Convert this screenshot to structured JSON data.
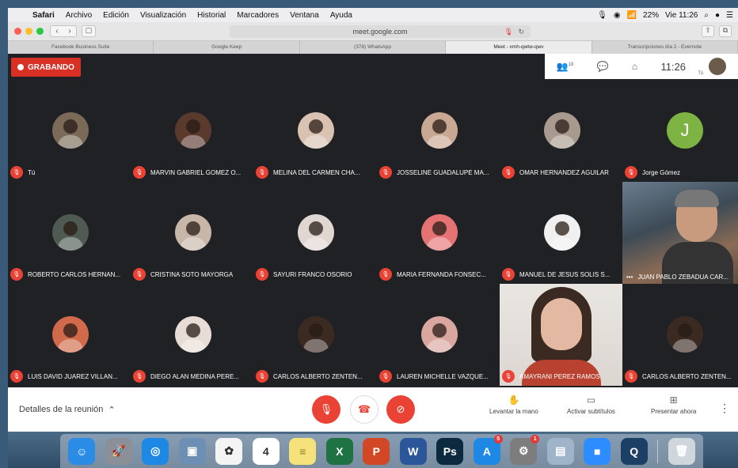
{
  "menubar": {
    "app": "Safari",
    "items": [
      "Archivo",
      "Edición",
      "Visualización",
      "Historial",
      "Marcadores",
      "Ventana",
      "Ayuda"
    ],
    "battery": "22%",
    "clock": "Vie 11:26"
  },
  "browser": {
    "url": "meet.google.com",
    "tabs": [
      {
        "label": "Facebook Business Suite",
        "active": false
      },
      {
        "label": "Google Keep",
        "active": false
      },
      {
        "label": "(378) WhatsApp",
        "active": false
      },
      {
        "label": "Meet - xmh-qwtw-qwv",
        "active": true
      },
      {
        "label": "Transcripciones día 2 - Evernote",
        "active": false
      }
    ]
  },
  "meet": {
    "recording_label": "GRABANDO",
    "participants_count": "18",
    "time": "11:26",
    "self_label": "Tú",
    "tiles": [
      {
        "name": "Tú",
        "type": "avatar",
        "color": "#7b6a58",
        "letter": ""
      },
      {
        "name": "MARVIN GABRIEL GOMEZ O...",
        "type": "avatar",
        "color": "#5b3a2e",
        "letter": ""
      },
      {
        "name": "MELINA DEL CARMEN CHA...",
        "type": "avatar",
        "color": "#d9c2b2",
        "letter": ""
      },
      {
        "name": "JOSSELINE GUADALUPE MA...",
        "type": "avatar",
        "color": "#c9a893",
        "letter": ""
      },
      {
        "name": "OMAR HERNANDEZ AGUILAR",
        "type": "avatar",
        "color": "#a89a8e",
        "letter": ""
      },
      {
        "name": "Jorge Gómez",
        "type": "avatar",
        "color": "#7cb342",
        "letter": "J"
      },
      {
        "name": "ROBERTO CARLOS HERNAN...",
        "type": "avatar",
        "color": "#4e5a52",
        "letter": ""
      },
      {
        "name": "CRISTINA SOTO MAYORGA",
        "type": "avatar",
        "color": "#c8b7a8",
        "letter": ""
      },
      {
        "name": "SAYURI FRANCO OSORIO",
        "type": "avatar",
        "color": "#e0d6d2",
        "letter": ""
      },
      {
        "name": "MARIA FERNANDA FONSEC...",
        "type": "avatar",
        "color": "#e57373",
        "letter": ""
      },
      {
        "name": "MANUEL DE JESUS SOLIS S...",
        "type": "avatar",
        "color": "#f0f0f0",
        "letter": ""
      },
      {
        "name": "JUAN PABLO ZEBADUA CAR...",
        "type": "video",
        "color": "",
        "letter": ""
      },
      {
        "name": "LUIS DAVID JUAREZ VILLAN...",
        "type": "avatar",
        "color": "#d06a4a",
        "letter": ""
      },
      {
        "name": "DIEGO ALAN MEDINA PERE...",
        "type": "avatar",
        "color": "#e8ddd6",
        "letter": ""
      },
      {
        "name": "CARLOS ALBERTO ZENTEN...",
        "type": "avatar",
        "color": "#3b2a22",
        "letter": ""
      },
      {
        "name": "LAUREN MICHELLE VAZQUE...",
        "type": "avatar",
        "color": "#d9a7a0",
        "letter": ""
      },
      {
        "name": "AMAYRANI PEREZ RAMOS",
        "type": "video",
        "color": "",
        "letter": ""
      },
      {
        "name": "CARLOS ALBERTO ZENTEN...",
        "type": "avatar",
        "color": "#3b2a22",
        "letter": ""
      }
    ]
  },
  "controls": {
    "details_label": "Detalles de la reunión",
    "raise_hand": "Levantar la mano",
    "captions": "Activar subtítulos",
    "present": "Presentar ahora"
  },
  "dock": {
    "apps": [
      {
        "name": "finder",
        "color": "#2b8ce6",
        "glyph": "☺",
        "badge": ""
      },
      {
        "name": "launchpad",
        "color": "#8a8f98",
        "glyph": "🚀",
        "badge": ""
      },
      {
        "name": "safari",
        "color": "#1e88e5",
        "glyph": "◎",
        "badge": ""
      },
      {
        "name": "preview",
        "color": "#6d8fb3",
        "glyph": "▣",
        "badge": ""
      },
      {
        "name": "photos",
        "color": "#f4f4f4",
        "glyph": "✿",
        "badge": ""
      },
      {
        "name": "calendar",
        "color": "#ffffff",
        "glyph": "4",
        "badge": ""
      },
      {
        "name": "notes",
        "color": "#f6e27a",
        "glyph": "≡",
        "badge": ""
      },
      {
        "name": "excel",
        "color": "#1f7244",
        "glyph": "X",
        "badge": ""
      },
      {
        "name": "powerpoint",
        "color": "#d24726",
        "glyph": "P",
        "badge": ""
      },
      {
        "name": "word",
        "color": "#2b579a",
        "glyph": "W",
        "badge": ""
      },
      {
        "name": "photoshop",
        "color": "#0b2a3f",
        "glyph": "Ps",
        "badge": ""
      },
      {
        "name": "app-store",
        "color": "#1e88e5",
        "glyph": "A",
        "badge": "5"
      },
      {
        "name": "system-preferences",
        "color": "#7d7d7d",
        "glyph": "⚙",
        "badge": "1"
      },
      {
        "name": "image-capture",
        "color": "#9fb4c8",
        "glyph": "▤",
        "badge": ""
      },
      {
        "name": "zoom",
        "color": "#2d8cff",
        "glyph": "■",
        "badge": ""
      },
      {
        "name": "quicktime",
        "color": "#1c3f66",
        "glyph": "Q",
        "badge": ""
      },
      {
        "name": "trash",
        "color": "#cfd6dc",
        "glyph": "🗑",
        "badge": ""
      }
    ]
  }
}
